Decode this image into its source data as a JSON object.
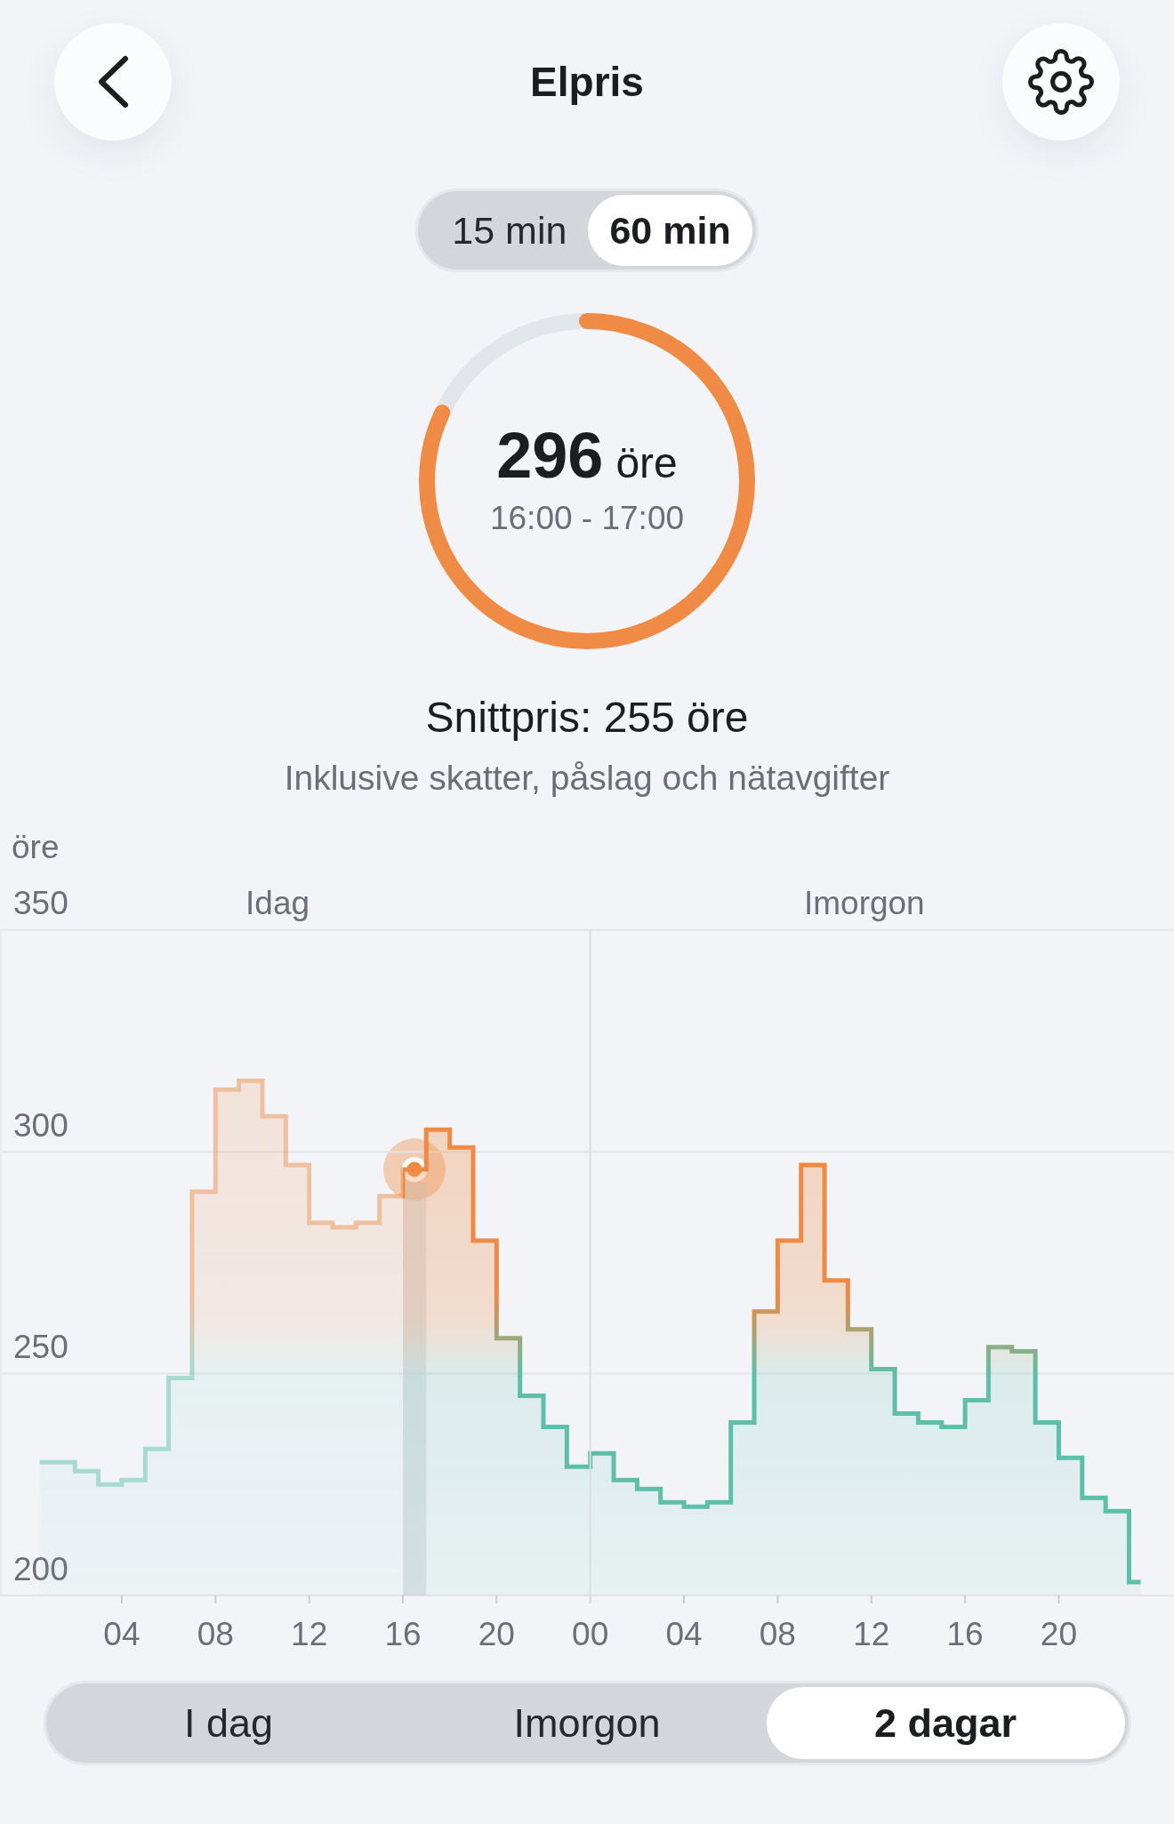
{
  "header": {
    "title": "Elpris"
  },
  "interval_toggle": [
    {
      "label": "15 min",
      "selected": false
    },
    {
      "label": "60 min",
      "selected": true
    }
  ],
  "price_gauge": {
    "value": "296",
    "unit": "öre",
    "time_range": "16:00 - 17:00",
    "level": 0.82
  },
  "average": {
    "text": "Snittpris: 255 öre",
    "note": "Inklusive skatter, påslag och nätavgifter"
  },
  "price_chart": {
    "chart_data": {
      "type": "area",
      "ylabel": "öre",
      "x": [
        0.5,
        1.5,
        2.5,
        3.5,
        4.5,
        5.5,
        6.5,
        7.5,
        8.5,
        9.5,
        10.5,
        11.5,
        12.5,
        13.5,
        14.5,
        15.5,
        16.5,
        17.5,
        18.5,
        19.5,
        20.5,
        21.5,
        22.5,
        23.5,
        24.5,
        25.5,
        26.5,
        27.5,
        28.5,
        29.5,
        30.5,
        31.5,
        32.5,
        33.5,
        34.5,
        35.5,
        36.5,
        37.5,
        38.5,
        39.5,
        40.5,
        41.5,
        42.5,
        43.5,
        44.5,
        45.5,
        46.5,
        47.5
      ],
      "series": [
        {
          "values": [
            230,
            230,
            228,
            225,
            226,
            233,
            249,
            291,
            314,
            316,
            308,
            297,
            284,
            283,
            284,
            290,
            296,
            305,
            301,
            280,
            258,
            245,
            238,
            229,
            232,
            226,
            224,
            221,
            220,
            221,
            239,
            264,
            280,
            297,
            271,
            260,
            251,
            241,
            239,
            238,
            244,
            256,
            255,
            239,
            231,
            222,
            219,
            203
          ]
        }
      ],
      "xlim": [
        -1.2,
        48.92
      ],
      "ylim": [
        200,
        350
      ],
      "xticks": [
        {
          "value": 4,
          "label": "04"
        },
        {
          "value": 8,
          "label": "08"
        },
        {
          "value": 12,
          "label": "12"
        },
        {
          "value": 16,
          "label": "16"
        },
        {
          "value": 20,
          "label": "20"
        },
        {
          "value": 24,
          "label": "00"
        },
        {
          "value": 28,
          "label": "04"
        },
        {
          "value": 32,
          "label": "08"
        },
        {
          "value": 36,
          "label": "12"
        },
        {
          "value": 40,
          "label": "16"
        },
        {
          "value": 44,
          "label": "20"
        }
      ],
      "yticks": [
        200,
        250,
        300,
        350
      ],
      "ref_lines": [
        {
          "axis": "x",
          "value": 24
        }
      ],
      "bands": [
        {
          "axis": "x",
          "from": 16,
          "to": 17
        }
      ],
      "annotations": [
        "Idag",
        "Imorgon"
      ]
    }
  },
  "day_tabs": [
    {
      "label": "I dag",
      "selected": false
    },
    {
      "label": "Imorgon",
      "selected": false
    },
    {
      "label": "2 dagar",
      "selected": true
    }
  ]
}
